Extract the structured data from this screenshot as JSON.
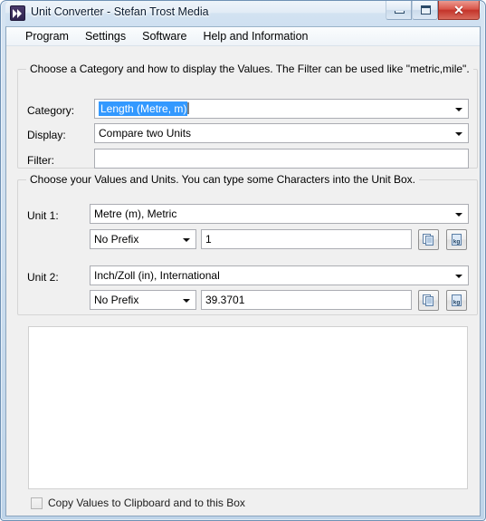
{
  "window": {
    "title": "Unit Converter - Stefan Trost Media",
    "icon": "double-arrow-icon",
    "buttons": {
      "minimize": "minimize-icon",
      "maximize": "maximize-icon",
      "close": "✕"
    }
  },
  "menubar": {
    "items": [
      {
        "label": "Program"
      },
      {
        "label": "Settings"
      },
      {
        "label": "Software"
      },
      {
        "label": "Help and Information"
      }
    ]
  },
  "category_group": {
    "caption": "Choose a Category and how to display the Values. The Filter can be used like \"metric,mile\".",
    "rows": {
      "category": {
        "label": "Category:",
        "value": "Length (Metre, m)",
        "selected": true
      },
      "display": {
        "label": "Display:",
        "value": "Compare two Units"
      },
      "filter": {
        "label": "Filter:",
        "value": "",
        "placeholder": ""
      }
    }
  },
  "units_group": {
    "caption": "Choose your Values and Units. You can type some Characters into the Unit Box.",
    "unit1": {
      "label": "Unit 1:",
      "unit": "Metre (m), Metric",
      "prefix": "No Prefix",
      "value": "1",
      "copy_button": "copy-icon",
      "unit_button": "kg-icon"
    },
    "unit2": {
      "label": "Unit 2:",
      "unit": "Inch/Zoll (in), International",
      "prefix": "No Prefix",
      "value": "39.3701",
      "copy_button": "copy-icon",
      "unit_button": "kg-icon"
    }
  },
  "output": {
    "text": ""
  },
  "footer": {
    "checkbox_label": "Copy Values to Clipboard and to this Box",
    "checked": false
  },
  "colors": {
    "selection_blue": "#3399ff",
    "window_frame": "#bed4e9",
    "client_bg": "#f0f0f0",
    "close_red": "#c3342a"
  }
}
